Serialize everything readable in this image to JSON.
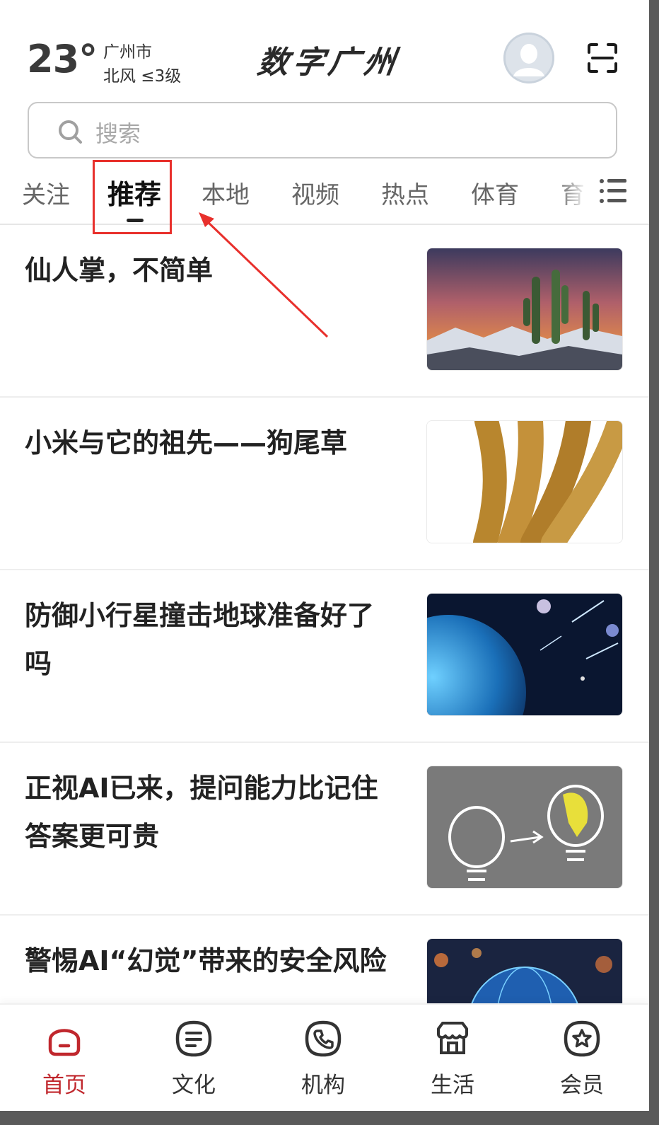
{
  "header": {
    "temperature": "23°",
    "city": "广州市",
    "wind": "北风 ≤3级",
    "logo_text": "数字广州",
    "avatar_icon": "avatar-icon",
    "scan_icon": "scan-icon"
  },
  "search": {
    "placeholder": "搜索"
  },
  "tabs": [
    {
      "label": "关注",
      "active": false
    },
    {
      "label": "推荐",
      "active": true
    },
    {
      "label": "本地",
      "active": false
    },
    {
      "label": "视频",
      "active": false
    },
    {
      "label": "热点",
      "active": false
    },
    {
      "label": "体育",
      "active": false
    },
    {
      "label": "育",
      "active": false
    }
  ],
  "feed": [
    {
      "title": "仙人掌，不简单",
      "thumb": "cactus-photo"
    },
    {
      "title": "小米与它的祖先——狗尾草",
      "thumb": "millet-photo"
    },
    {
      "title": "防御小行星撞击地球准备好了吗",
      "thumb": "planet-photo"
    },
    {
      "title": "正视AI已来，提问能力比记住答案更可贵",
      "thumb": "lightbulb-photo"
    },
    {
      "title": "警惕AI“幻觉”带来的安全风险",
      "thumb": "globe-network-photo"
    }
  ],
  "bottom_nav": [
    {
      "label": "首页",
      "icon": "home-icon",
      "active": true
    },
    {
      "label": "文化",
      "icon": "culture-icon",
      "active": false
    },
    {
      "label": "机构",
      "icon": "phone-icon",
      "active": false
    },
    {
      "label": "生活",
      "icon": "store-icon",
      "active": false
    },
    {
      "label": "会员",
      "icon": "star-icon",
      "active": false
    }
  ],
  "colors": {
    "accent": "#c0272d",
    "annotation": "#e8302c"
  }
}
